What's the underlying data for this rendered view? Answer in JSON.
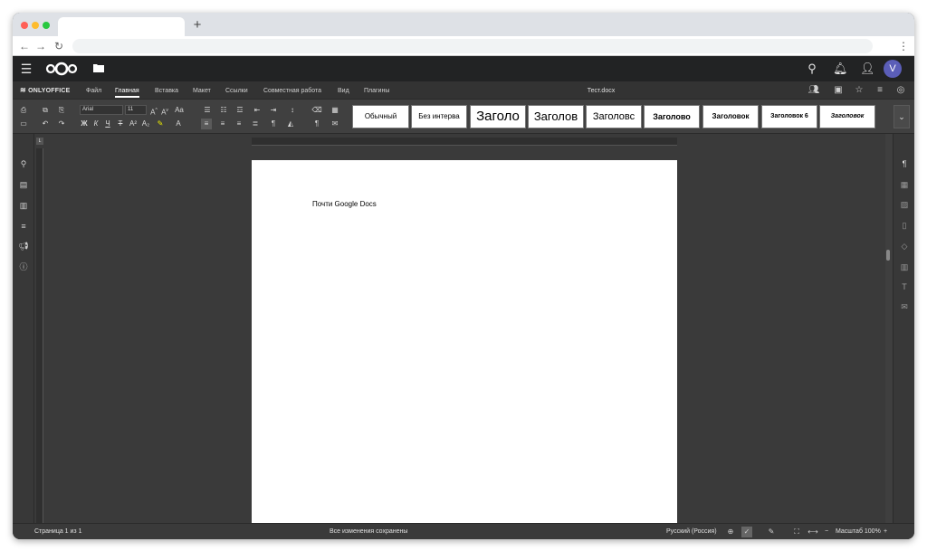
{
  "browser": {
    "new_tab_label": "+",
    "back_icon": "arrow-left-icon",
    "forward_icon": "arrow-right-icon",
    "reload_icon": "reload-icon",
    "menu_icon": "kebab-menu-icon"
  },
  "nextcloud": {
    "logo": "nextcloud-logo",
    "avatar_letter": "V",
    "avatar_color": "#5b5eb8"
  },
  "onlyoffice": {
    "logo_text": "ONLYOFFICE",
    "tabs": [
      "Файл",
      "Главная",
      "Вставка",
      "Макет",
      "Ссылки",
      "Совместная работа",
      "Вид",
      "Плагины"
    ],
    "active_tab": "Главная",
    "document_title": "Тест.docx"
  },
  "toolbar": {
    "font_name": "Arial",
    "font_size": "11",
    "styles": [
      "Обычный",
      "Без интерва",
      "Заголо",
      "Заголов",
      "Заголовс",
      "Заголово",
      "Заголовок",
      "Заголовок 6",
      "Заголовок"
    ]
  },
  "document": {
    "body_text": "Почти Google Docs"
  },
  "statusbar": {
    "page_info": "Страница 1 из 1",
    "save_status": "Все изменения сохранены",
    "language": "Русский (Россия)",
    "zoom_label": "Масштаб 100%",
    "zoom_out": "−",
    "zoom_in": "+"
  },
  "colors": {
    "header_bg": "#222324",
    "toolbar_bg": "#404040",
    "canvas_bg": "#3a3a3a",
    "page_bg": "#ffffff"
  }
}
